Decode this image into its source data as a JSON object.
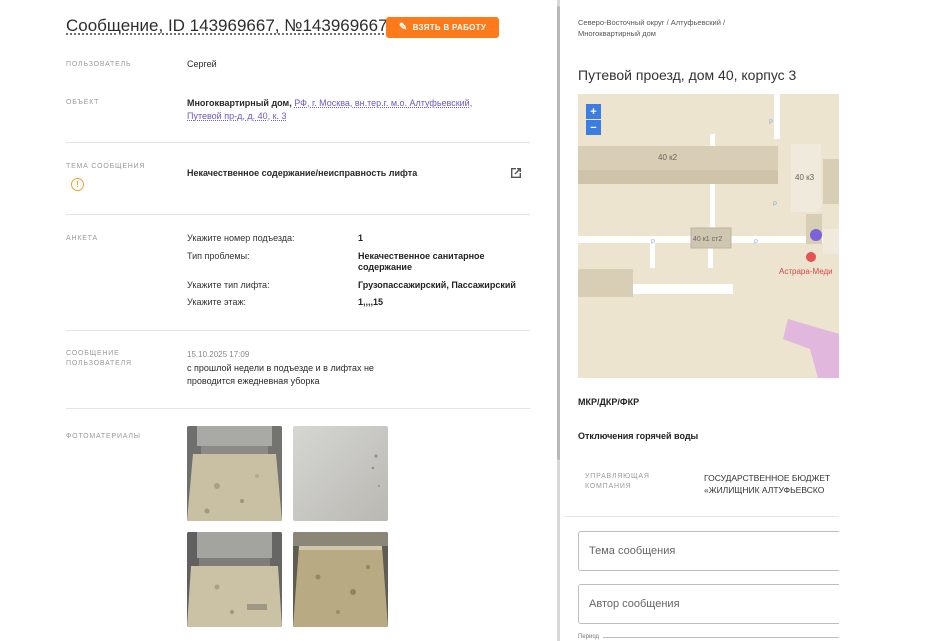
{
  "header": {
    "title": "Сообщение, ID 143969667, №143969667",
    "take_button": "ВЗЯТЬ В РАБОТУ"
  },
  "fields": {
    "user_label": "ПОЛЬЗОВАТЕЛЬ",
    "user_value": "Сергей",
    "object_label": "ОБЪЕКТ",
    "object_type": "Многоквартирный дом,",
    "object_link_1": "РФ, г. Москва, вн.тер.г. м.о. Алтуфьевский,",
    "object_link_2": "Путевой пр-д, д. 40, к. 3",
    "topic_label": "ТЕМА СООБЩЕНИЯ",
    "topic_value": "Некачественное содержание/неисправность лифта",
    "form_label": "АНКЕТА",
    "message_label_1": "СООБЩЕНИЕ",
    "message_label_2": "ПОЛЬЗОВАТЕЛЯ",
    "message_date": "15.10.2025 17:09",
    "message_line_1": "с прошлой недели в подъезде и в лифтах не",
    "message_line_2": "проводится ежедневная уборка",
    "photos_label": "ФОТОМАТЕРИАЛЫ"
  },
  "form": {
    "rows": [
      {
        "q": "Укажите номер подъезда:",
        "a": "1"
      },
      {
        "q": "Тип проблемы:",
        "a": "Некачественное санитарное содержание"
      },
      {
        "q": "Укажите тип лифта:",
        "a": "Грузопассажирский, Пассажирский"
      },
      {
        "q": "Укажите этаж:",
        "a": "1,,,,15"
      }
    ]
  },
  "right": {
    "breadcrumb_1": "Северо-Восточный округ / Алтуфьевский /",
    "breadcrumb_2": "Многоквартирный дом",
    "address": "Путевой проезд, дом 40, корпус 3",
    "map": {
      "label_k2": "40 к2",
      "label_k3": "40 к3",
      "label_k1": "40 к1 ст2",
      "poi": "Астрара-Меди",
      "zoom_in": "+",
      "zoom_out": "−"
    },
    "section_1": "МКР/ДКР/ФКР",
    "section_2": "Отключения горячей воды",
    "uk_label_1": "УПРАВЛЯЮЩАЯ",
    "uk_label_2": "КОМПАНИЯ",
    "uk_value_1": "ГОСУДАРСТВЕННОЕ БЮДЖЕТ",
    "uk_value_2": "«ЖИЛИЩНИК АЛТУФЬЕВСКО",
    "field_topic": "Тема сообщения",
    "field_author": "Автор сообщения",
    "period_label": "Период"
  },
  "colors": {
    "accent": "#ff7a1a",
    "link": "#6a5acd",
    "warning": "#f0a030",
    "map_zoom": "#3b7de0"
  }
}
